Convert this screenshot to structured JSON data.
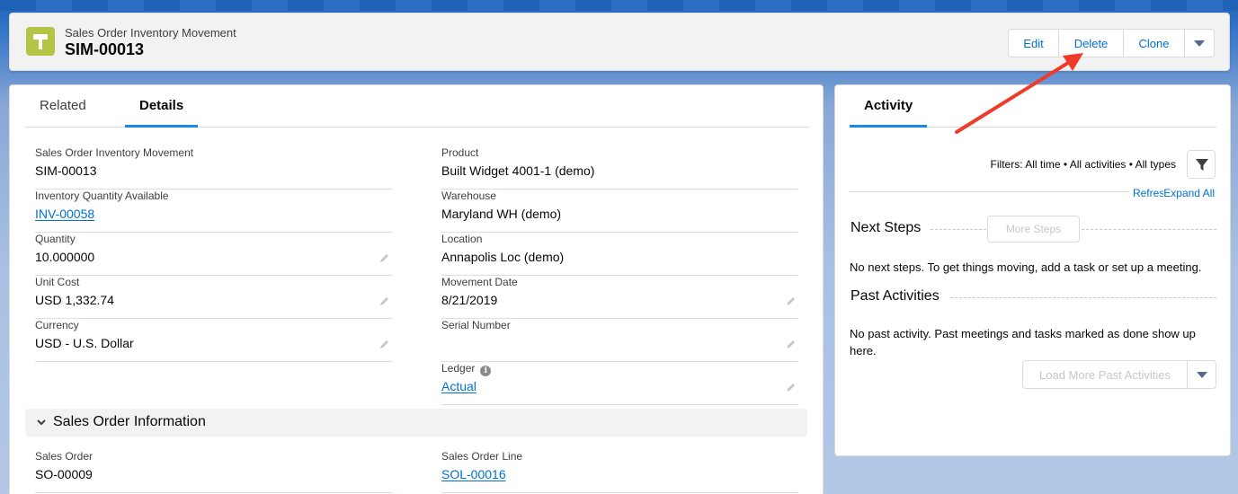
{
  "header": {
    "object_type": "Sales Order Inventory Movement",
    "record_name": "SIM-00013",
    "buttons": {
      "edit": "Edit",
      "delete": "Delete",
      "clone": "Clone"
    }
  },
  "tabs": {
    "related": "Related",
    "details": "Details"
  },
  "fields": {
    "movement": {
      "label": "Sales Order Inventory Movement",
      "value": "SIM-00013"
    },
    "product": {
      "label": "Product",
      "value": "Built Widget 4001-1 (demo)"
    },
    "inventory_qty": {
      "label": "Inventory Quantity Available",
      "value": "INV-00058"
    },
    "warehouse": {
      "label": "Warehouse",
      "value": "Maryland WH (demo)"
    },
    "quantity": {
      "label": "Quantity",
      "value": "10.000000"
    },
    "location": {
      "label": "Location",
      "value": "Annapolis Loc (demo)"
    },
    "unit_cost": {
      "label": "Unit Cost",
      "value": "USD 1,332.74"
    },
    "movement_date": {
      "label": "Movement Date",
      "value": "8/21/2019"
    },
    "currency": {
      "label": "Currency",
      "value": "USD - U.S. Dollar"
    },
    "serial_number": {
      "label": "Serial Number",
      "value": ""
    },
    "ledger": {
      "label": "Ledger",
      "value": "Actual"
    }
  },
  "section": {
    "title": "Sales Order Information",
    "sales_order": {
      "label": "Sales Order",
      "value": "SO-00009"
    },
    "sales_order_line": {
      "label": "Sales Order Line",
      "value": "SOL-00016"
    }
  },
  "activity": {
    "tab": "Activity",
    "filters": "Filters: All time • All activities • All types",
    "refresh": "Refresh",
    "expand_all": "Expand All",
    "next_steps": "Next Steps",
    "more_steps": "More Steps",
    "no_next_steps": "No next steps. To get things moving, add a task or set up a meeting.",
    "past_activities": "Past Activities",
    "no_past_activity": "No past activity. Past meetings and tasks marked as done show up here.",
    "load_more": "Load More Past Activities"
  },
  "colors": {
    "accent": "#0070d2",
    "annotation_arrow": "#ee3b2b",
    "object_icon": "#b6c446"
  }
}
